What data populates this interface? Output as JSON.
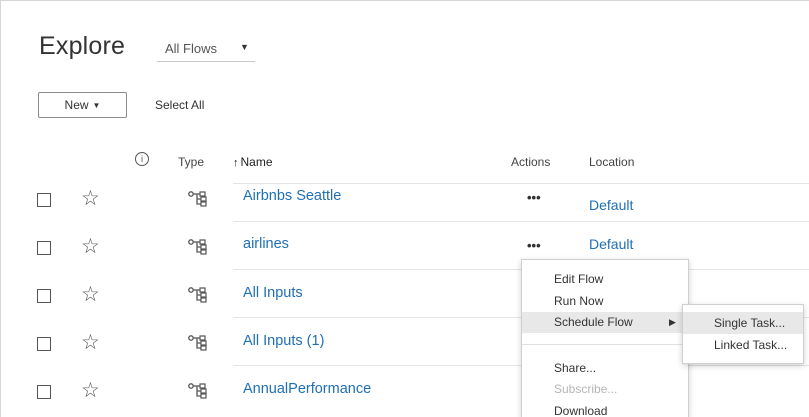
{
  "header": {
    "title": "Explore",
    "filter_label": "All Flows",
    "filter_caret": "▼"
  },
  "toolbar": {
    "new_label": "New",
    "new_caret": "▼",
    "select_all_label": "Select All"
  },
  "columns": {
    "info_symbol": "i",
    "type": "Type",
    "name_sort": "↑",
    "name": "Name",
    "actions": "Actions",
    "location": "Location"
  },
  "rows": [
    {
      "name": "Airbnbs Seattle",
      "actions": "•••",
      "location": "Default"
    },
    {
      "name": "airlines",
      "actions": "•••",
      "location": "Default"
    },
    {
      "name": "All Inputs",
      "actions": "",
      "location": ""
    },
    {
      "name": "All Inputs (1)",
      "actions": "",
      "location": ""
    },
    {
      "name": "AnnualPerformance",
      "actions": "",
      "location": ""
    }
  ],
  "context_menu": {
    "items": [
      {
        "label": "Edit Flow",
        "state": "normal"
      },
      {
        "label": "Run Now",
        "state": "normal"
      },
      {
        "label": "Schedule Flow",
        "state": "active",
        "submenu_arrow": "▶"
      },
      {
        "label": "Share...",
        "state": "normal"
      },
      {
        "label": "Subscribe...",
        "state": "disabled"
      },
      {
        "label": "Download",
        "state": "normal"
      }
    ]
  },
  "submenu": {
    "items": [
      {
        "label": "Single Task...",
        "state": "hover"
      },
      {
        "label": "Linked Task...",
        "state": "normal"
      }
    ]
  },
  "icons": {
    "star": "star-outline-icon",
    "flow": "flow-type-icon",
    "checkbox": "checkbox-icon",
    "info": "info-icon"
  },
  "colors": {
    "link": "#1f6fb5",
    "menu_active": "#e8e8e8",
    "disabled_text": "#b5b5b5"
  }
}
